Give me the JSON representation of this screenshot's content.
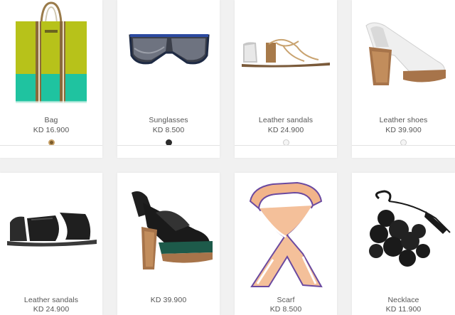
{
  "products": [
    {
      "name": "Bag",
      "price": "KD 16.900",
      "swatches": [
        {
          "color": "#7a5a2a",
          "ring": "#c9a36a"
        }
      ]
    },
    {
      "name": "Sunglasses",
      "price": "KD 8.500",
      "swatches": [
        {
          "color": "#2b2b2b",
          "ring": "#2b2b2b"
        }
      ]
    },
    {
      "name": "Leather sandals",
      "price": "KD 24.900",
      "swatches": [
        {
          "color": "#f5f5f5",
          "ring": "#cccccc"
        }
      ]
    },
    {
      "name": "Leather shoes",
      "price": "KD 39.900",
      "swatches": [
        {
          "color": "#f5f5f5",
          "ring": "#cccccc"
        }
      ]
    },
    {
      "name": "Leather sandals",
      "price": "KD 24.900",
      "swatches": []
    },
    {
      "name": "",
      "price": "KD 39.900",
      "swatches": []
    },
    {
      "name": "Scarf",
      "price": "KD 8.500",
      "swatches": []
    },
    {
      "name": "Necklace",
      "price": "KD 11.900",
      "swatches": []
    }
  ],
  "colors": {
    "background": "#f1f1f1",
    "card": "#ffffff",
    "text": "#555555"
  }
}
